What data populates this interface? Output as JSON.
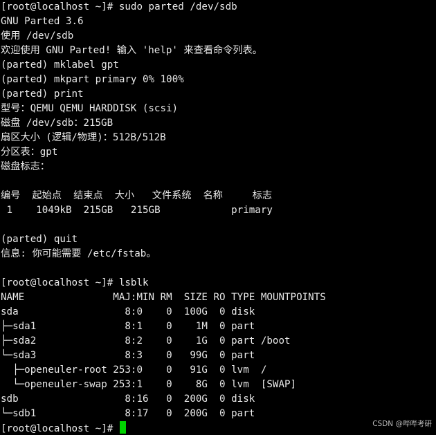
{
  "terminal": {
    "lines": [
      "[root@localhost ~]# sudo parted /dev/sdb",
      "GNU Parted 3.6",
      "使用 /dev/sdb",
      "欢迎使用 GNU Parted! 输入 'help' 来查看命令列表。",
      "(parted) mklabel gpt",
      "(parted) mkpart primary 0% 100%",
      "(parted) print",
      "型号：QEMU QEMU HARDDISK (scsi)",
      "磁盘 /dev/sdb：215GB",
      "扇区大小 (逻辑/物理)：512B/512B",
      "分区表：gpt",
      "磁盘标志：",
      "",
      "编号  起始点  结束点  大小   文件系统  名称     标志",
      " 1    1049kB  215GB   215GB            primary",
      "",
      "(parted) quit",
      "信息: 你可能需要 /etc/fstab。",
      "",
      "[root@localhost ~]# lsblk",
      "NAME               MAJ:MIN RM  SIZE RO TYPE MOUNTPOINTS",
      "sda                  8:0    0  100G  0 disk",
      "├─sda1               8:1    0    1M  0 part",
      "├─sda2               8:2    0    1G  0 part /boot",
      "└─sda3               8:3    0   99G  0 part",
      "  ├─openeuler-root 253:0    0   91G  0 lvm  /",
      "  └─openeuler-swap 253:1    0    8G  0 lvm  [SWAP]",
      "sdb                  8:16   0  200G  0 disk",
      "└─sdb1               8:17   0  200G  0 part"
    ],
    "prompt": "[root@localhost ~]# ",
    "cursor_color": "#00d400",
    "background_color": "#000000",
    "text_color": "#e8e8e8"
  },
  "watermark": {
    "text": "CSDN @哔哔考研"
  }
}
